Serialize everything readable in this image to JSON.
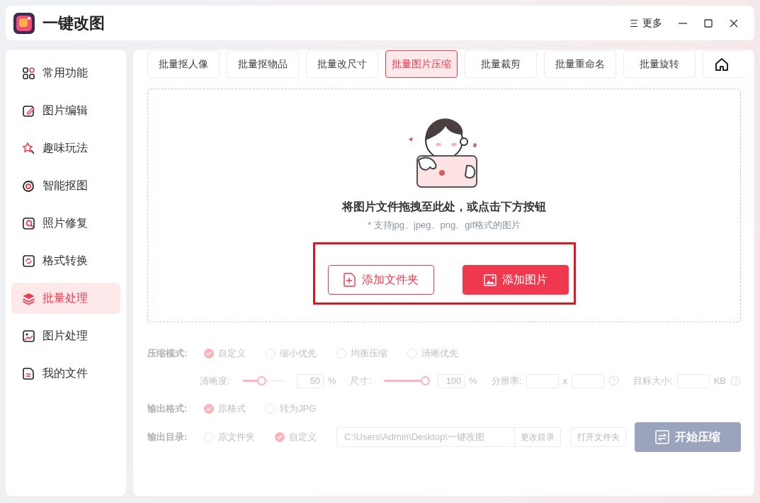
{
  "app": {
    "title": "一键改图",
    "menu_label": "更多"
  },
  "sidebar": {
    "items": [
      {
        "label": "常用功能",
        "selected": false
      },
      {
        "label": "图片编辑",
        "selected": false
      },
      {
        "label": "趣味玩法",
        "selected": false
      },
      {
        "label": "智能抠图",
        "selected": false
      },
      {
        "label": "照片修复",
        "selected": false
      },
      {
        "label": "格式转换",
        "selected": false
      },
      {
        "label": "批量处理",
        "selected": true
      },
      {
        "label": "图片处理",
        "selected": false
      },
      {
        "label": "我的文件",
        "selected": false
      }
    ]
  },
  "tabs": [
    {
      "label": "批量抠人像",
      "selected": false
    },
    {
      "label": "批量抠物品",
      "selected": false
    },
    {
      "label": "批量改尺寸",
      "selected": false
    },
    {
      "label": "批量图片压缩",
      "selected": true
    },
    {
      "label": "批量裁剪",
      "selected": false
    },
    {
      "label": "批量重命名",
      "selected": false
    },
    {
      "label": "批量旋转",
      "selected": false
    }
  ],
  "drop_zone": {
    "heading": "将图片文件拖拽至此处，或点击下方按钮",
    "hint": "* 支持jpg、jpeg、png、gif格式的图片",
    "highlighted": true,
    "buttons": [
      {
        "label": "添加文件夹",
        "kind": "outline"
      },
      {
        "label": "添加图片",
        "kind": "primary"
      }
    ]
  },
  "settings": {
    "disabled": true,
    "compress_mode": {
      "label": "压缩模式:",
      "options": [
        {
          "label": "自定义",
          "selected": true
        },
        {
          "label": "缩小优先",
          "selected": false
        },
        {
          "label": "均衡压缩",
          "selected": false
        },
        {
          "label": "清晰优先",
          "selected": false
        }
      ]
    },
    "quality": {
      "label": "清晰度:",
      "level": 0.45,
      "value": "50",
      "unit": "%"
    },
    "size": {
      "label": "尺寸:",
      "level": 1,
      "value": "100",
      "unit": "%"
    },
    "resolution": {
      "label": "分辨率:",
      "separator": "x"
    },
    "target_size": {
      "label": "目标大小:",
      "unit": "KB"
    },
    "output_format": {
      "label": "输出格式:",
      "options": [
        {
          "label": "原格式",
          "selected": true
        },
        {
          "label": "转为JPG",
          "selected": false
        }
      ]
    },
    "output_dir": {
      "label": "输出目录:",
      "options": [
        {
          "label": "原文件夹",
          "selected": false
        },
        {
          "label": "自定义",
          "selected": true
        }
      ],
      "path": "C:\\Users\\Admin\\Desktop\\一键改图",
      "change_button": "更改目录",
      "open_button": "打开文件夹"
    },
    "start_button": "开始压缩"
  }
}
